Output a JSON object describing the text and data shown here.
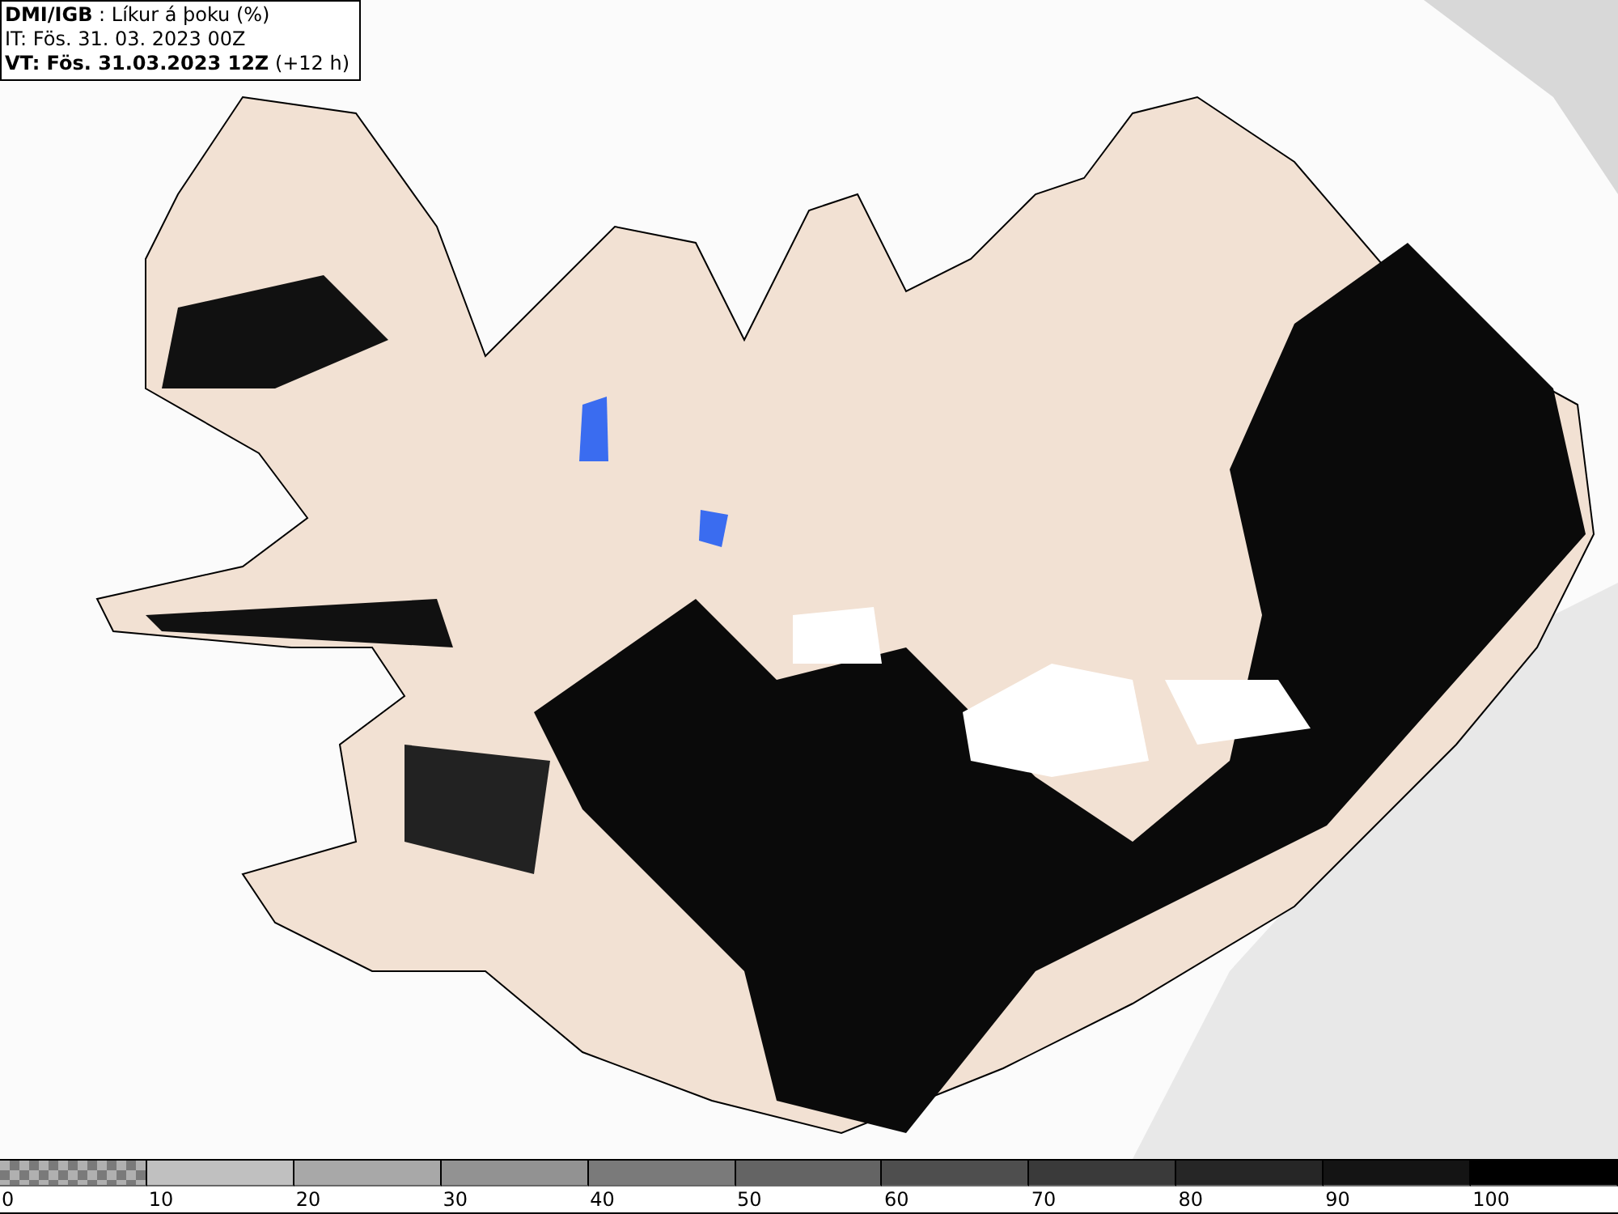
{
  "header": {
    "title": "**DMI/IGB** : Líkur á þoku (%)",
    "issue_time": "IT: Fös. 31. 03. 2023 00Z",
    "valid_time": "**VT: Fös. 31.03.2023 12Z** (+12 h)"
  },
  "legend": [
    {
      "label": "0",
      "kind": "checker",
      "color": "#7a7a7a"
    },
    {
      "label": "10",
      "kind": "solid",
      "color": "#c0c0c0"
    },
    {
      "label": "20",
      "kind": "solid",
      "color": "#a8a8a8"
    },
    {
      "label": "30",
      "kind": "solid",
      "color": "#929292"
    },
    {
      "label": "40",
      "kind": "solid",
      "color": "#7a7a7a"
    },
    {
      "label": "50",
      "kind": "solid",
      "color": "#646464"
    },
    {
      "label": "60",
      "kind": "solid",
      "color": "#4e4e4e"
    },
    {
      "label": "70",
      "kind": "solid",
      "color": "#3a3a3a"
    },
    {
      "label": "80",
      "kind": "solid",
      "color": "#262626"
    },
    {
      "label": "90",
      "kind": "solid",
      "color": "#141414"
    },
    {
      "label": "100",
      "kind": "solid",
      "color": "#000000"
    }
  ]
}
